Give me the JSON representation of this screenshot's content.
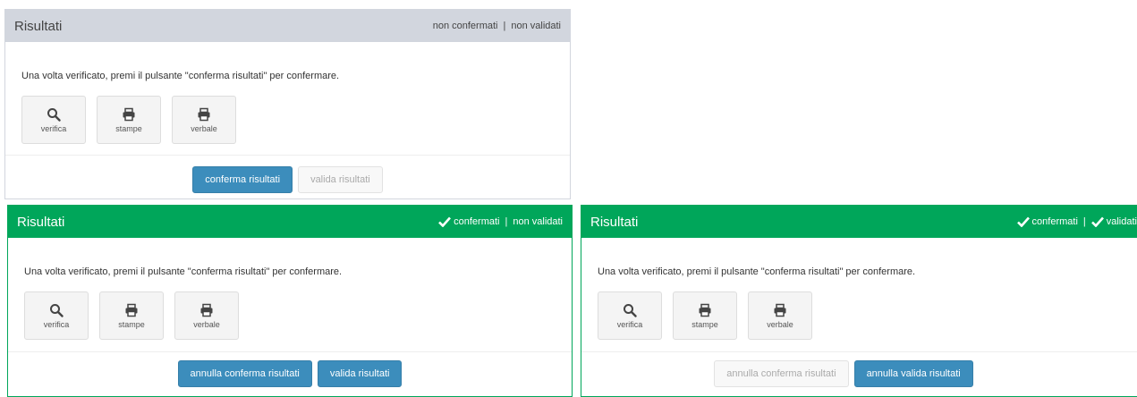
{
  "panels": [
    {
      "title": "Risultati",
      "status_left": "non confermati",
      "status_sep": "|",
      "status_right": "non validati",
      "instruction": "Una volta verificato, premi il pulsante \"conferma risultati\" per confermare.",
      "tools": [
        "verifica",
        "stampe",
        "verbale"
      ],
      "buttons": [
        "conferma risultati",
        "valida risultati"
      ]
    },
    {
      "title": "Risultati",
      "status_left": "confermati",
      "status_sep": "|",
      "status_right": "non validati",
      "instruction": "Una volta verificato, premi il pulsante \"conferma risultati\" per confermare.",
      "tools": [
        "verifica",
        "stampe",
        "verbale"
      ],
      "buttons": [
        "annulla conferma risultati",
        "valida risultati"
      ]
    },
    {
      "title": "Risultati",
      "status_left": "confermati",
      "status_sep": "|",
      "status_right": "validati",
      "instruction": "Una volta verificato, premi il pulsante \"conferma risultati\" per confermare.",
      "tools": [
        "verifica",
        "stampe",
        "verbale"
      ],
      "buttons": [
        "annulla conferma risultati",
        "annulla valida risultati"
      ]
    }
  ],
  "icons": {
    "tools": [
      "search-icon",
      "printer-icon",
      "printer-icon"
    ],
    "status_check": "check-icon"
  },
  "colors": {
    "header_gray": "#d2d6de",
    "header_green": "#00a65a",
    "primary_button": "#3c8dbc"
  }
}
